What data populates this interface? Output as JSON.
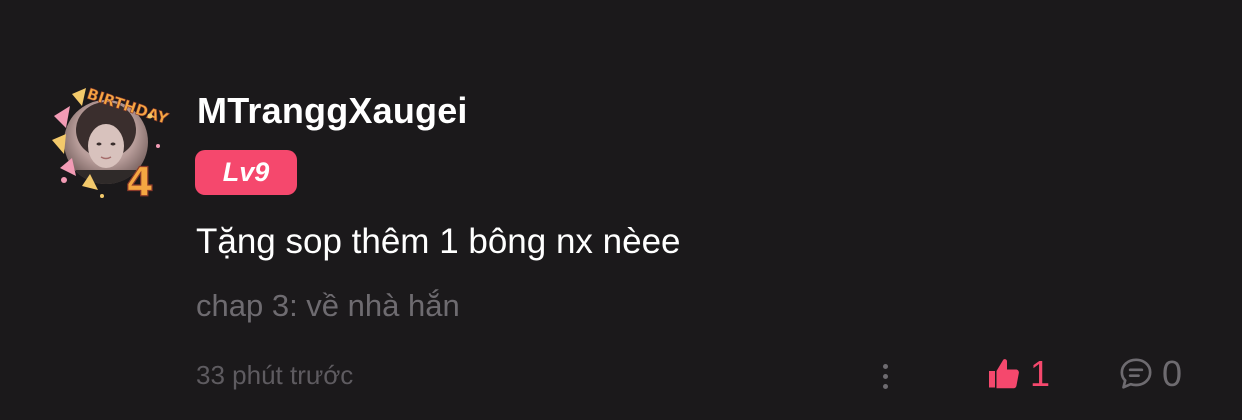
{
  "comment": {
    "username": "MTranggXaugei",
    "level": "Lv9",
    "text": "Tặng sop thêm 1 bông nx nèee",
    "chapter": "chap 3: về nhà hắn",
    "timestamp": "33 phút trước",
    "likes": "1",
    "replies": "0",
    "avatar_frame_text": "BIRTHDAY",
    "avatar_frame_number": "4"
  },
  "icons": {
    "more": "more-vertical-icon",
    "like": "thumbs-up-icon",
    "reply": "comment-bubble-icon"
  },
  "colors": {
    "background": "#1b191b",
    "accent": "#f5486d",
    "muted": "#6e6b70",
    "text": "#ffffff"
  }
}
